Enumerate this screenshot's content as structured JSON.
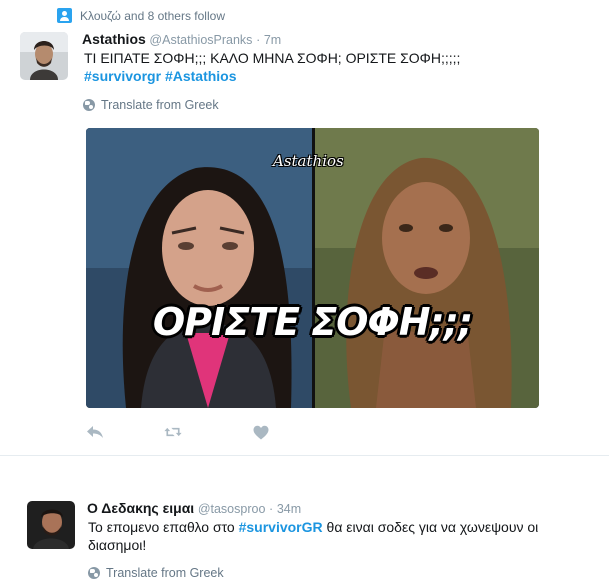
{
  "tweet1": {
    "context": "Κλουζώ and 8 others follow",
    "name": "Astathios",
    "handle": "@AstathiosPranks",
    "separator": "·",
    "time": "7m",
    "text": "ΤΙ ΕΙΠΑΤΕ ΣΟΦΗ;;; ΚΑΛΟ ΜΗΝΑ ΣΟΦΗ; ΟΡΙΣΤΕ ΣΟΦΗ;;;;;",
    "hashtag1": "#survivorgr",
    "hashtag2": "#Astathios",
    "translate": "Translate from Greek",
    "media": {
      "watermark": "Astathios",
      "caption": "ΟΡΙΣΤΕ ΣΟΦΗ;;;"
    }
  },
  "tweet2": {
    "name": "Ο Δεδακης ειμαι",
    "handle": "@tasosproo",
    "separator": "·",
    "time": "34m",
    "text_before": "Το επομενο επαθλο στο ",
    "hashtag": "#survivorGR",
    "text_after": "  θα ειναι σοδες για να χωνεψουν οι διασημοι!",
    "translate": "Translate from Greek"
  },
  "icons": {
    "follow": "person-follow-icon",
    "globe": "globe-icon",
    "reply": "reply-icon",
    "retweet": "retweet-icon",
    "like": "heart-icon"
  },
  "colors": {
    "hashtag": "#1b95e0",
    "meta": "#8899a6",
    "context_icon": "#2aa3ef",
    "action_icon": "#aab8c2"
  }
}
